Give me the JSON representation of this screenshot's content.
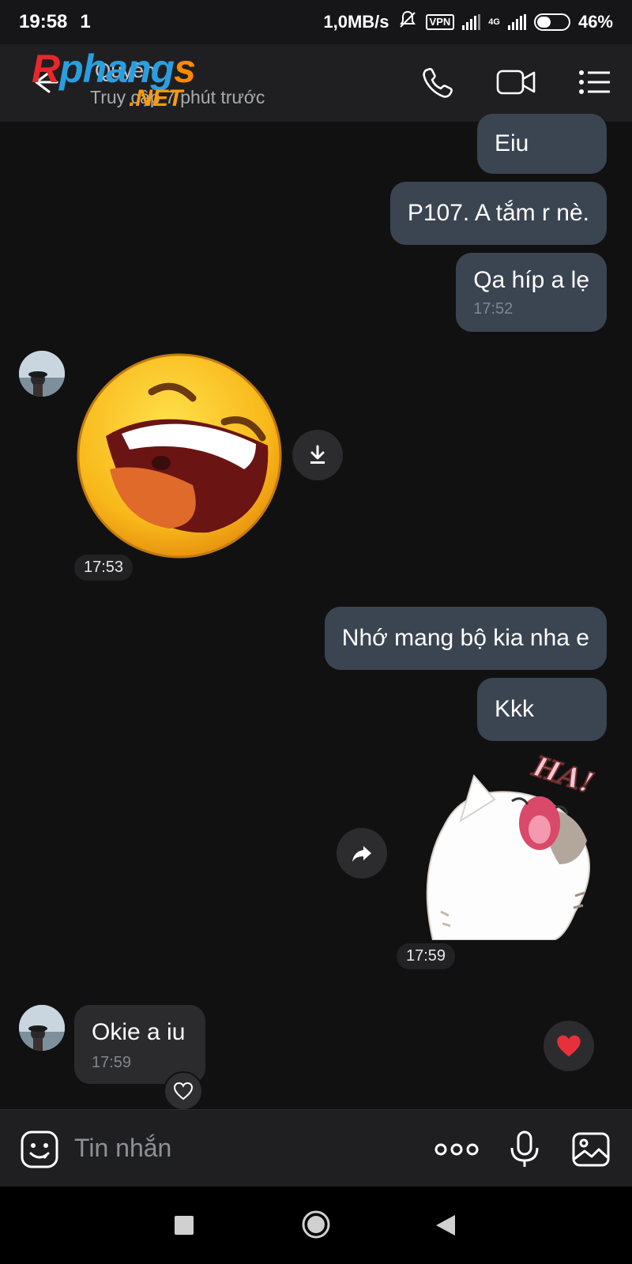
{
  "status_bar": {
    "time": "19:58",
    "extra": "1",
    "network_speed": "1,0MB/s",
    "vpn": "VPN",
    "network_type": "4G",
    "battery": "46%",
    "battery_level": 0.46
  },
  "header": {
    "contact_name": "Quyên",
    "status": "Truy cập 7 phút trước",
    "watermark_parts": [
      "R",
      "phang",
      "s"
    ],
    "watermark_net": ".NET",
    "icons": [
      "back-arrow-icon",
      "phone-icon",
      "video-call-icon",
      "menu-list-icon"
    ]
  },
  "messages": [
    {
      "direction": "out",
      "text": "Eiu"
    },
    {
      "direction": "out",
      "text": "P107. A tắm r nè."
    },
    {
      "direction": "out",
      "text": "Qa híp a lẹ",
      "time": "17:52"
    },
    {
      "direction": "in",
      "type": "sticker",
      "sticker": "laughing-emoji-sticker",
      "time": "17:53"
    },
    {
      "direction": "out",
      "text": "Nhớ mang bộ kia nha e"
    },
    {
      "direction": "out",
      "text": "Kkk"
    },
    {
      "direction": "out",
      "type": "sticker",
      "sticker": "laughing-cat-sticker",
      "sticker_text": "HA!",
      "time": "17:59"
    },
    {
      "direction": "in",
      "text": "Okie a iu",
      "time": "17:59"
    }
  ],
  "input": {
    "placeholder": "Tin nhắn"
  },
  "colors": {
    "background": "#111112",
    "outgoing_bubble": "#3b4451",
    "incoming_bubble": "#2b2b2d",
    "header": "#1f1f21",
    "heart": "#e8303a"
  }
}
